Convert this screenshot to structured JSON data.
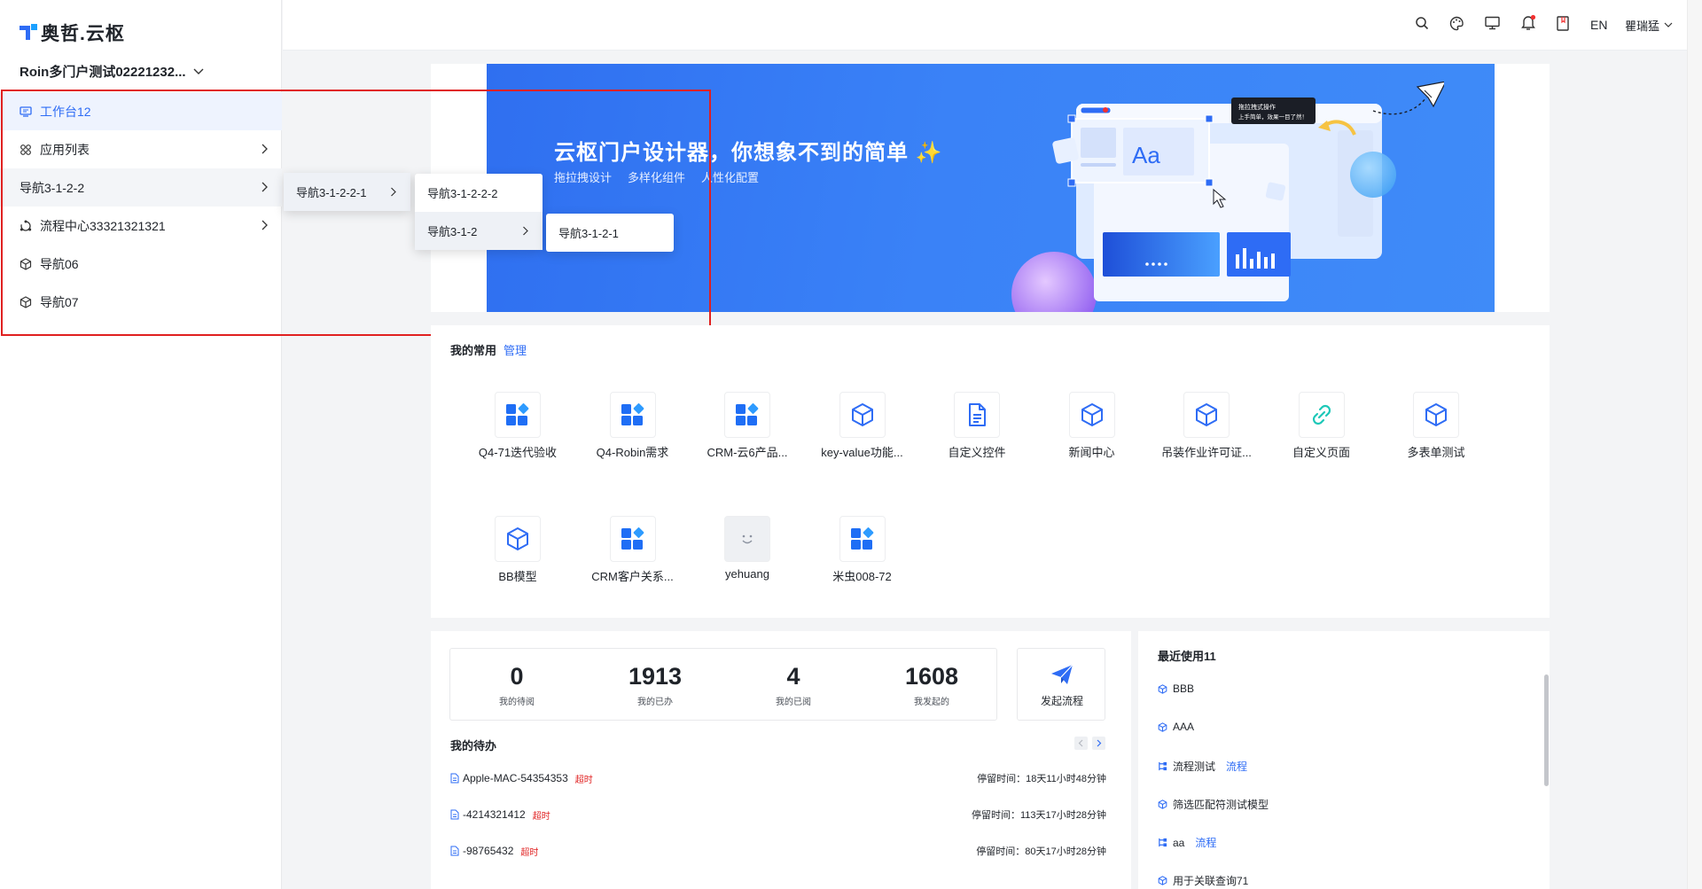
{
  "brand": {
    "logo_text": "奥哲.云枢"
  },
  "tenant": {
    "name": "Roin多门户测试02221232..."
  },
  "sidebar": {
    "items": [
      {
        "label": "工作台12",
        "icon": "workbench-icon"
      },
      {
        "label": "应用列表",
        "icon": "app-grid-icon"
      },
      {
        "label": "导航3-1-2-2",
        "icon": ""
      },
      {
        "label": "流程中心33321321321",
        "icon": "flow-icon"
      },
      {
        "label": "导航06",
        "icon": "cube-icon"
      },
      {
        "label": "导航07",
        "icon": "cube-icon"
      }
    ]
  },
  "flyout1": {
    "items": [
      {
        "label": "导航3-1-2-2-1"
      }
    ]
  },
  "flyout2": {
    "items": [
      {
        "label": "导航3-1-2-2-2"
      },
      {
        "label": "导航3-1-2"
      }
    ]
  },
  "flyout3": {
    "items": [
      {
        "label": "导航3-1-2-1"
      }
    ]
  },
  "topbar": {
    "lang": "EN",
    "user": "瞿瑞猛",
    "icons": [
      "search-icon",
      "theme-icon",
      "monitor-icon",
      "bell-icon",
      "book-icon"
    ]
  },
  "banner": {
    "title": "云枢门户设计器，你想象不到的简单 ✨",
    "subtitles": [
      "拖拉拽设计",
      "多样化组件",
      "人性化配置"
    ],
    "tooltip_line1": "拖拉拽式操作",
    "tooltip_line2": "上手简单，效果一目了然！",
    "preview_text": "Aa"
  },
  "favorites": {
    "title": "我的常用",
    "manage": "管理",
    "apps": [
      {
        "label": "Q4-71迭代验收",
        "icon": "grid-app-icon"
      },
      {
        "label": "Q4-Robin需求",
        "icon": "grid-app-icon"
      },
      {
        "label": "CRM-云6产品...",
        "icon": "grid-app-icon"
      },
      {
        "label": "key-value功能...",
        "icon": "cube-icon"
      },
      {
        "label": "自定义控件",
        "icon": "document-icon"
      },
      {
        "label": "新闻中心",
        "icon": "cube-icon"
      },
      {
        "label": "吊装作业许可证...",
        "icon": "cube-icon"
      },
      {
        "label": "自定义页面",
        "icon": "link-icon"
      },
      {
        "label": "多表单测试",
        "icon": "cube-icon"
      },
      {
        "label": "BB模型",
        "icon": "cube-icon"
      },
      {
        "label": "CRM客户关系...",
        "icon": "grid-app-icon"
      },
      {
        "label": "yehuang",
        "icon": "smile-icon"
      },
      {
        "label": "米虫008-72",
        "icon": "grid-app-icon"
      }
    ]
  },
  "stats": [
    {
      "value": "0",
      "label": "我的待阅"
    },
    {
      "value": "1913",
      "label": "我的已办"
    },
    {
      "value": "4",
      "label": "我的已阅"
    },
    {
      "value": "1608",
      "label": "我发起的"
    }
  ],
  "start_flow": {
    "label": "发起流程"
  },
  "todos": {
    "title": "我的待办",
    "items": [
      {
        "name": "Apple-MAC-54354353",
        "tag": "超时",
        "time": "停留时间：18天11小时48分钟"
      },
      {
        "name": "-4214321412",
        "tag": "超时",
        "time": "停留时间：113天17小时28分钟"
      },
      {
        "name": "-98765432",
        "tag": "超时",
        "time": "停留时间：80天17小时28分钟"
      }
    ]
  },
  "recent": {
    "title": "最近使用11",
    "items": [
      {
        "name": "BBB",
        "type": "",
        "icon": "cube-icon"
      },
      {
        "name": "AAA",
        "type": "",
        "icon": "cube-icon"
      },
      {
        "name": "流程测试",
        "type": "流程",
        "icon": "flow-node-icon"
      },
      {
        "name": "筛选匹配符测试模型",
        "type": "",
        "icon": "cube-icon"
      },
      {
        "name": "aa",
        "type": "流程",
        "icon": "flow-node-icon"
      },
      {
        "name": "用于关联查询71",
        "type": "",
        "icon": "cube-icon"
      }
    ]
  },
  "colors": {
    "accent": "#2e6cf5",
    "danger": "#e02020",
    "banner": "#3a82f7"
  }
}
